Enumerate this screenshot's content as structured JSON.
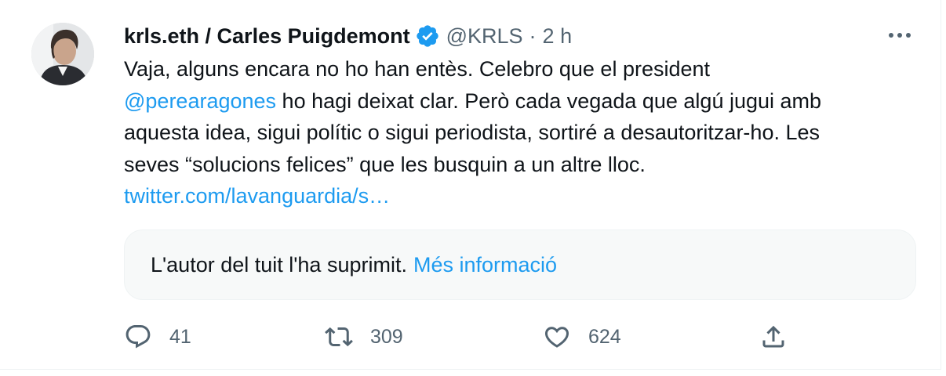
{
  "tweet": {
    "display_name": "krls.eth / Carles Puigdemont",
    "handle": "@KRLS",
    "separator": "·",
    "time": "2 h",
    "body": {
      "line1": "Vaja, alguns encara no ho han entès. Celebro que el president",
      "mention": "@perearagones",
      "line2_rest": " ho hagi deixat clar. Però cada vegada que algú jugui amb",
      "line3": "aquesta idea, sigui polític o sigui periodista, sortiré a desautoritzar-ho. Les",
      "line4": "seves “solucions felices” que les busquin a un altre lloc.",
      "link": "twitter.com/lavanguardia/s…"
    },
    "quoted": {
      "deleted_text": "L'autor del tuit l'ha suprimit.",
      "more_info": "Més informació"
    },
    "actions": {
      "replies": "41",
      "retweets": "309",
      "likes": "624"
    },
    "icons": {
      "verified": "verified-badge-icon",
      "more": "more-options-icon",
      "reply": "reply-icon",
      "retweet": "retweet-icon",
      "like": "like-icon",
      "share": "share-icon"
    },
    "colors": {
      "accent": "#1d9bf0",
      "muted": "#536471",
      "text": "#0f1419",
      "quote_bg": "#f7f9f9"
    }
  }
}
